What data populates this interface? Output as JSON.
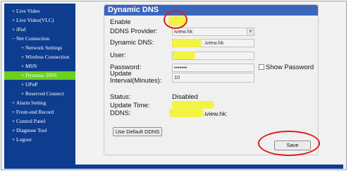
{
  "sidebar": {
    "items": [
      {
        "bullet": "+",
        "label": "Live Video"
      },
      {
        "bullet": "+",
        "label": "Live Video(VLC)"
      },
      {
        "bullet": "+",
        "label": "iPad"
      },
      {
        "bullet": "−",
        "label": "Net Connection"
      },
      {
        "bullet": "+",
        "label": "Network Settings"
      },
      {
        "bullet": "+",
        "label": "Wireless Connection"
      },
      {
        "bullet": "+",
        "label": "MSN"
      },
      {
        "bullet": "+",
        "label": "Dynamic DNS"
      },
      {
        "bullet": "+",
        "label": "UPnP"
      },
      {
        "bullet": "+",
        "label": "Reserved Connect"
      },
      {
        "bullet": "+",
        "label": "Alarm Setting"
      },
      {
        "bullet": "+",
        "label": "Front-end Record"
      },
      {
        "bullet": "+",
        "label": "Control Panel"
      },
      {
        "bullet": "+",
        "label": "Diagnose Tool"
      },
      {
        "bullet": "+",
        "label": "Logout"
      }
    ],
    "active_label": "Dynamic DNS"
  },
  "panel": {
    "title": "Dynamic DNS",
    "enable_label": "Enable",
    "provider_label": "DDNS Provider:",
    "provider_value": "iview.hk",
    "dynamic_dns_label": "Dynamic DNS:",
    "dynamic_dns_value": ".iview.hk",
    "user_label": "User:",
    "password_label": "Password:",
    "password_value": "•••••••",
    "show_password_label": "Show Password",
    "interval_label_1": "Update",
    "interval_label_2": "Interval(Minutes):",
    "interval_value": "10",
    "status_label": "Status:",
    "status_value": "Disabled",
    "update_time_label": "Update Time:",
    "ddns_label": "DDNS:",
    "ddns_value": ".iview.hk:",
    "default_button": "Use Default DDNS",
    "save_button": "Save"
  },
  "colors": {
    "sidebar_bg": "#0e3d8f",
    "active_item_bg": "#6ad11d",
    "panel_header_bg": "#3a66bd",
    "redaction": "#f2f23a",
    "annotation_red": "#e01b1b"
  }
}
